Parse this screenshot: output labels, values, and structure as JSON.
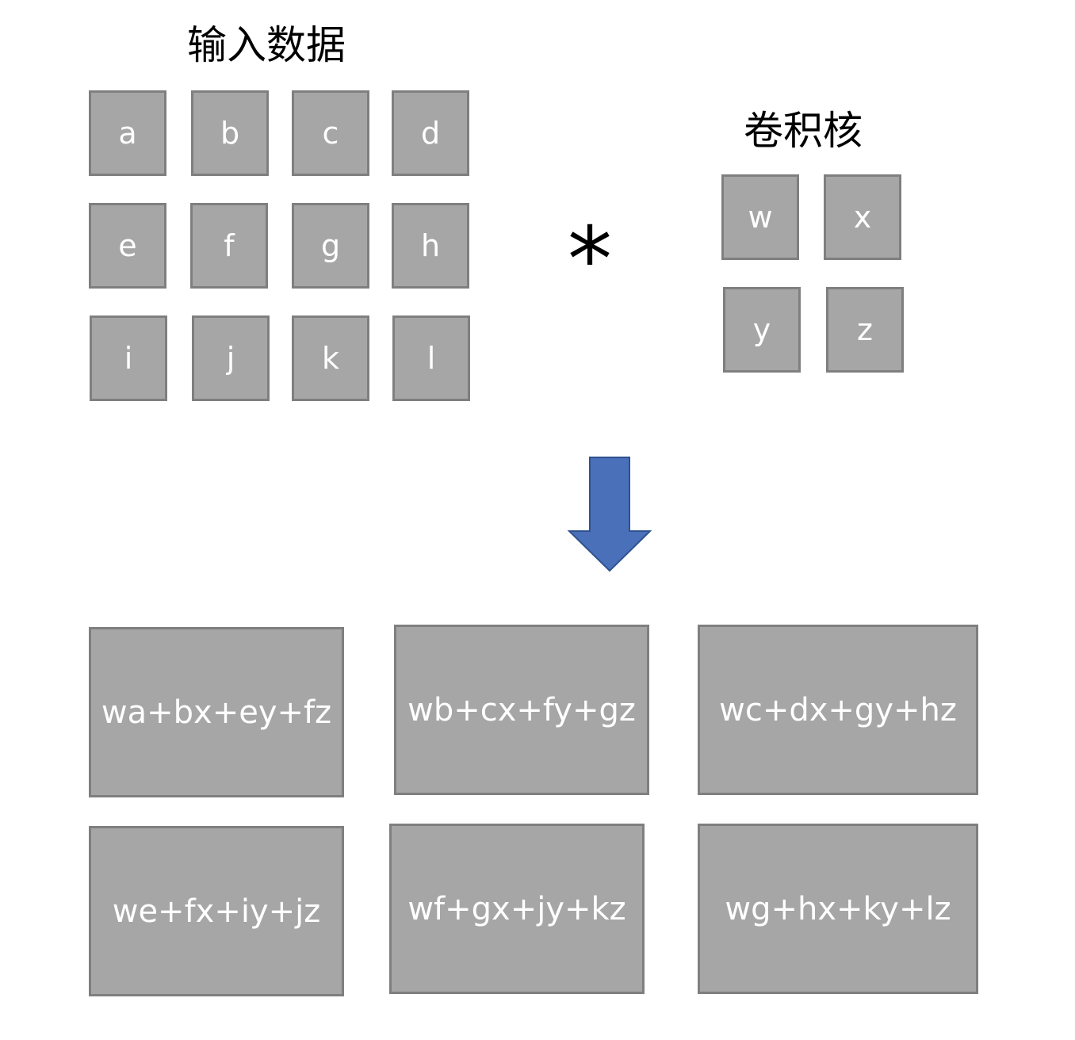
{
  "input": {
    "title": "输入数据",
    "cells": [
      "a",
      "b",
      "c",
      "d",
      "e",
      "f",
      "g",
      "h",
      "i",
      "j",
      "k",
      "l"
    ]
  },
  "operator": "*",
  "kernel": {
    "title": "卷积核",
    "cells": [
      "w",
      "x",
      "y",
      "z"
    ]
  },
  "arrow_color": "#4a70ba",
  "cell_fill": "#a6a6a6",
  "cell_border": "#7f7f7f",
  "output": {
    "cells": [
      "wa+bx+ey+fz",
      "wb+cx+fy+gz",
      "wc+dx+gy+hz",
      "we+fx+iy+jz",
      "wf+gx+jy+kz",
      "wg+hx+ky+lz"
    ]
  }
}
